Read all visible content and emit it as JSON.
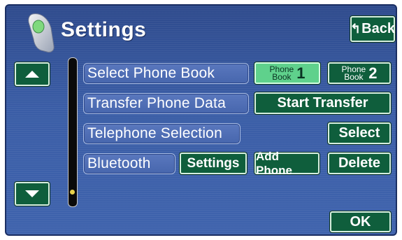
{
  "header": {
    "title": "Settings",
    "back_label": "Back"
  },
  "rows": [
    {
      "label": "Select Phone Book"
    },
    {
      "label": "Transfer Phone Data"
    },
    {
      "label": "Telephone Selection"
    },
    {
      "label": "Bluetooth"
    }
  ],
  "phone_book_1": {
    "line1": "Phone",
    "line2": "Book",
    "number": "1",
    "selected": true
  },
  "phone_book_2": {
    "line1": "Phone",
    "line2": "Book",
    "number": "2",
    "selected": false
  },
  "buttons": {
    "start_transfer": "Start Transfer",
    "select": "Select",
    "settings": "Settings",
    "add_phone": "Add Phone",
    "delete": "Delete",
    "ok": "OK"
  },
  "icons": {
    "phone": "phone-icon",
    "back": "back-arrow-icon",
    "up": "up-arrow-icon",
    "down": "down-arrow-icon"
  },
  "colors": {
    "background": "#3a5da6",
    "button": "#0f5e3c",
    "selected_button": "#5fd18c",
    "row_label": "#4766ad"
  }
}
